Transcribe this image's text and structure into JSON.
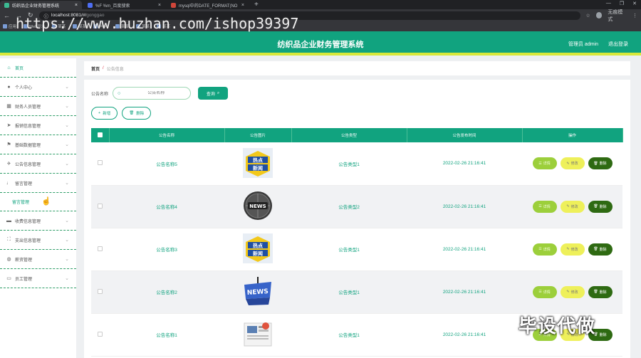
{
  "browser": {
    "tabs": [
      {
        "label": "纺织品企业财务管理系统",
        "active": true,
        "fav": "#3cba92"
      },
      {
        "label": "%F %m_百度搜索",
        "active": false,
        "fav": "#4e6ef2"
      },
      {
        "label": "mysql中的DATE_FORMAT(NO",
        "active": false,
        "fav": "#d0463a"
      }
    ],
    "new_tab": "+",
    "window_controls": [
      "—",
      "❐",
      "✕"
    ],
    "url": "localhost:8081/#/",
    "url_path": "gonggao",
    "user_mode": "无痕模式",
    "bookmarks": [
      "应用",
      "Web开发",
      "某某",
      "某某",
      "itcast",
      "某某",
      "某某",
      "某某"
    ]
  },
  "watermark": "https://www.huzhan.com/ishop39397",
  "corner_mark": "毕设代做",
  "header": {
    "title": "纺织品企业财务管理系统",
    "admin_label": "管理员 admin",
    "logout_label": "退出登录",
    "bg_color": "#11a37f",
    "accent_color": "#d9e83a"
  },
  "sidebar": {
    "items": [
      {
        "label": "首页",
        "icon": "home-icon",
        "glyph": "⌂"
      },
      {
        "label": "个人中心",
        "icon": "user-icon",
        "glyph": "●"
      },
      {
        "label": "财务人员管理",
        "icon": "grid-icon",
        "glyph": "▦"
      },
      {
        "label": "报销信息管理",
        "icon": "send-icon",
        "glyph": "➤"
      },
      {
        "label": "基础数据管理",
        "icon": "flag-icon",
        "glyph": "⚑"
      },
      {
        "label": "公告信息管理",
        "icon": "plane-icon",
        "glyph": "✈"
      },
      {
        "label": "留言管理",
        "icon": "mic-icon",
        "glyph": "♩"
      },
      {
        "sub": "留言管理"
      },
      {
        "label": "收费信息管理",
        "icon": "folder-icon",
        "glyph": "▬"
      },
      {
        "label": "支出信息管理",
        "icon": "frame-icon",
        "glyph": "⛶"
      },
      {
        "label": "薪资管理",
        "icon": "globe-icon",
        "glyph": "◍"
      },
      {
        "label": "员工管理",
        "icon": "monitor-icon",
        "glyph": "▭"
      }
    ]
  },
  "breadcrumb": {
    "home": "首页",
    "sep": "/",
    "current": "公告信息"
  },
  "search": {
    "label": "公告名称",
    "placeholder": "公告名称",
    "button": "查询"
  },
  "actions": {
    "add": "新增",
    "delete": "删除"
  },
  "table": {
    "columns": [
      "公告名称",
      "公告图片",
      "公告类型",
      "公告发布时间",
      "操作"
    ],
    "rows": [
      {
        "name": "公告名称5",
        "image": "news-badge-blue",
        "type": "公告类型1",
        "time": "2022-02-26 21:16:41"
      },
      {
        "name": "公告名称4",
        "image": "news-globe",
        "type": "公告类型2",
        "time": "2022-02-26 21:16:41"
      },
      {
        "name": "公告名称3",
        "image": "news-badge-blue",
        "type": "公告类型1",
        "time": "2022-02-26 21:16:41"
      },
      {
        "name": "公告名称2",
        "image": "news-3d-blue",
        "type": "公告类型1",
        "time": "2022-02-26 21:16:41"
      },
      {
        "name": "公告名称1",
        "image": "news-paper",
        "type": "公告类型1",
        "time": "2022-02-26 21:16:41"
      }
    ],
    "ops": {
      "detail": "详情",
      "edit": "修改",
      "delete": "删除"
    }
  }
}
